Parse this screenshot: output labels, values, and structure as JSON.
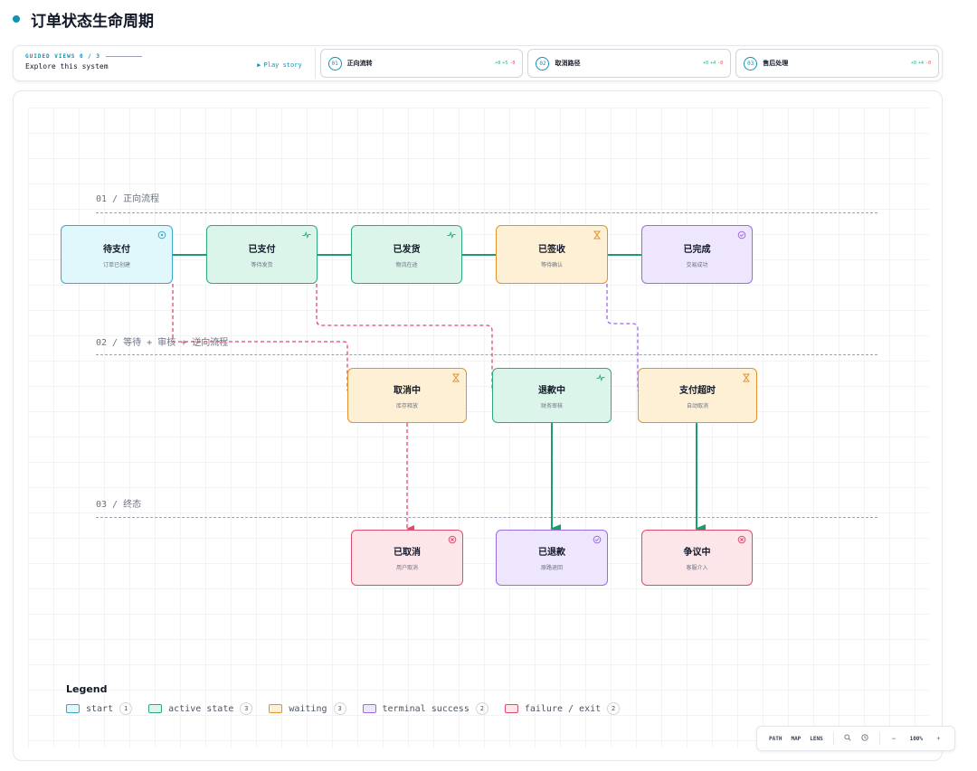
{
  "page": {
    "title": "订单状态生命周期"
  },
  "guided": {
    "counter": "GUIDED VIEWS 0 / 3",
    "subtitle": "Explore this system",
    "play_label": "Play story",
    "stories": [
      {
        "num": "01",
        "label": "正向流转",
        "plus": "+0",
        "mid": "+5",
        "minus": "-0"
      },
      {
        "num": "02",
        "label": "取消路径",
        "plus": "+0",
        "mid": "+4",
        "minus": "-0"
      },
      {
        "num": "03",
        "label": "售后处理",
        "plus": "+0",
        "mid": "+4",
        "minus": "-0"
      }
    ]
  },
  "sections": [
    {
      "label": "01 / 正向流程"
    },
    {
      "label": "02 / 等待 + 审核 + 逆向流程"
    },
    {
      "label": "03 / 终态"
    }
  ],
  "nodes": {
    "pending_payment": {
      "title": "待支付",
      "sub": "订单已创建",
      "kind": "start",
      "icon": "clock-icon"
    },
    "paid": {
      "title": "已支付",
      "sub": "等待发货",
      "kind": "active",
      "icon": "pulse-icon"
    },
    "shipped": {
      "title": "已发货",
      "sub": "物流在途",
      "kind": "active",
      "icon": "pulse-icon"
    },
    "signed": {
      "title": "已签收",
      "sub": "等待确认",
      "kind": "waiting",
      "icon": "hourglass-icon"
    },
    "completed": {
      "title": "已完成",
      "sub": "交易成功",
      "kind": "success",
      "icon": "check-circle-icon"
    },
    "cancelling": {
      "title": "取消中",
      "sub": "库存释放",
      "kind": "waiting",
      "icon": "hourglass-icon"
    },
    "refunding": {
      "title": "退款中",
      "sub": "财务审核",
      "kind": "active",
      "icon": "pulse-icon"
    },
    "payment_timeout": {
      "title": "支付超时",
      "sub": "自动取消",
      "kind": "waiting",
      "icon": "hourglass-icon"
    },
    "cancelled": {
      "title": "已取消",
      "sub": "用户取消",
      "kind": "failure",
      "icon": "x-circle-icon"
    },
    "refunded": {
      "title": "已退款",
      "sub": "原路退回",
      "kind": "success",
      "icon": "check-circle-icon"
    },
    "disputed": {
      "title": "争议中",
      "sub": "客服介入",
      "kind": "failure",
      "icon": "x-circle-icon"
    }
  },
  "legend": {
    "title": "Legend",
    "items": [
      {
        "label": "start",
        "count": "1",
        "color": "#3aa9c7",
        "fill": "#e0f7fc"
      },
      {
        "label": "active state",
        "count": "3",
        "color": "#2fa97a",
        "fill": "#dcf5ea"
      },
      {
        "label": "waiting",
        "count": "3",
        "color": "#e2922f",
        "fill": "#fdf0d4"
      },
      {
        "label": "terminal success",
        "count": "2",
        "color": "#9b6ae6",
        "fill": "#ede6fd"
      },
      {
        "label": "failure / exit",
        "count": "2",
        "color": "#e04b69",
        "fill": "#fde6ea"
      }
    ]
  },
  "toolbar": {
    "path": "PATH",
    "map": "MAP",
    "lens": "LENS",
    "zoom": "100%",
    "minus": "—",
    "plus": "+"
  },
  "colors": {
    "accent": "#0e93b5",
    "edge_green": "#1a9e6b",
    "edge_red": "#e04b69",
    "edge_purple": "#9b6ae6"
  }
}
